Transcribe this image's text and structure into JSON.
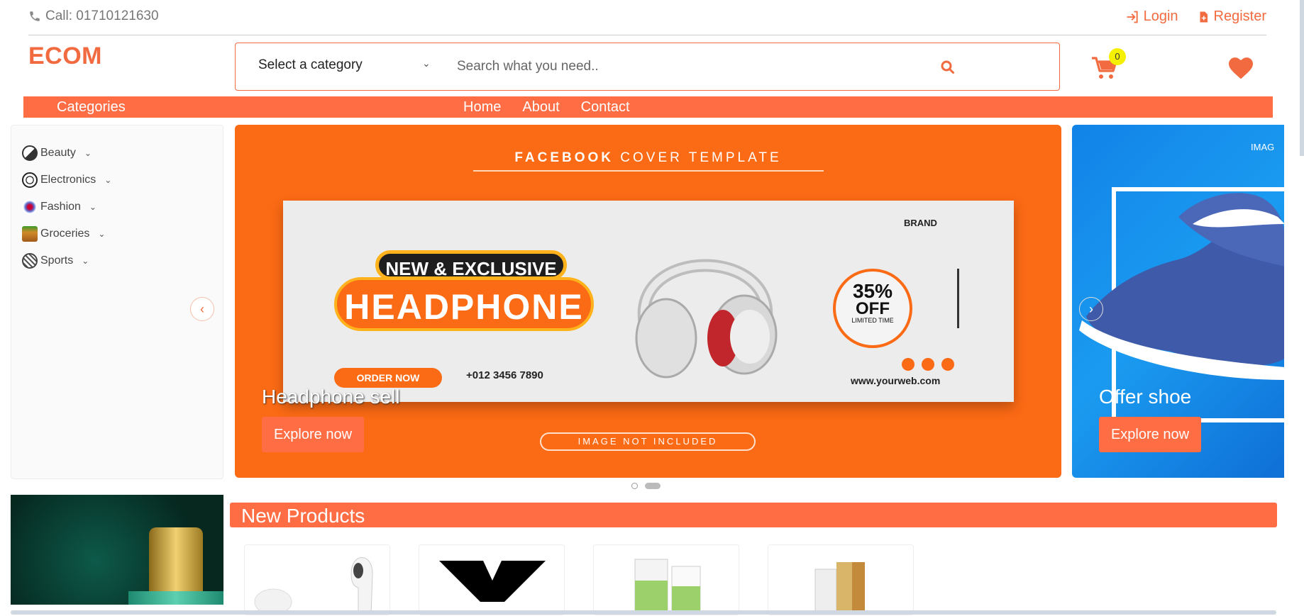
{
  "topbar": {
    "call": "Call: 01710121630",
    "login": "Login",
    "register": "Register"
  },
  "brand": {
    "logo": "ECOM"
  },
  "search": {
    "category": "Select a category",
    "placeholder": "Search what you need.."
  },
  "cart": {
    "count": "0"
  },
  "nav": {
    "categories": "Categories",
    "links": [
      "Home",
      "About",
      "Contact"
    ]
  },
  "sidebar": {
    "items": [
      {
        "label": "Beauty",
        "icon": "beauty-icon"
      },
      {
        "label": "Electronics",
        "icon": "electronics-icon"
      },
      {
        "label": "Fashion",
        "icon": "fashion-icon"
      },
      {
        "label": "Groceries",
        "icon": "groceries-icon"
      },
      {
        "label": "Sports",
        "icon": "sports-icon"
      }
    ]
  },
  "slides": [
    {
      "caption": "Headphone sell",
      "button": "Explore now",
      "image": {
        "header_bold": "FACEBOOK",
        "header_rest": " COVER TEMPLATE",
        "tag": "NEW & EXCLUSIVE",
        "headline": "HEADPHONE",
        "order": "ORDER NOW",
        "phone": "+012 3456 7890",
        "brand": "BRAND",
        "discount": "35%",
        "off": "OFF",
        "limited": "LIMITED TIME",
        "website": "www.yourweb.com",
        "note": "IMAGE NOT INCLUDED"
      }
    },
    {
      "caption": "Offer shoe",
      "button": "Explore now",
      "image_label": "IMAG"
    }
  ],
  "products": {
    "title": "New Products"
  },
  "colors": {
    "accent": "#ff6d45",
    "brand": "#f26a3f",
    "badge": "#f5f000"
  }
}
